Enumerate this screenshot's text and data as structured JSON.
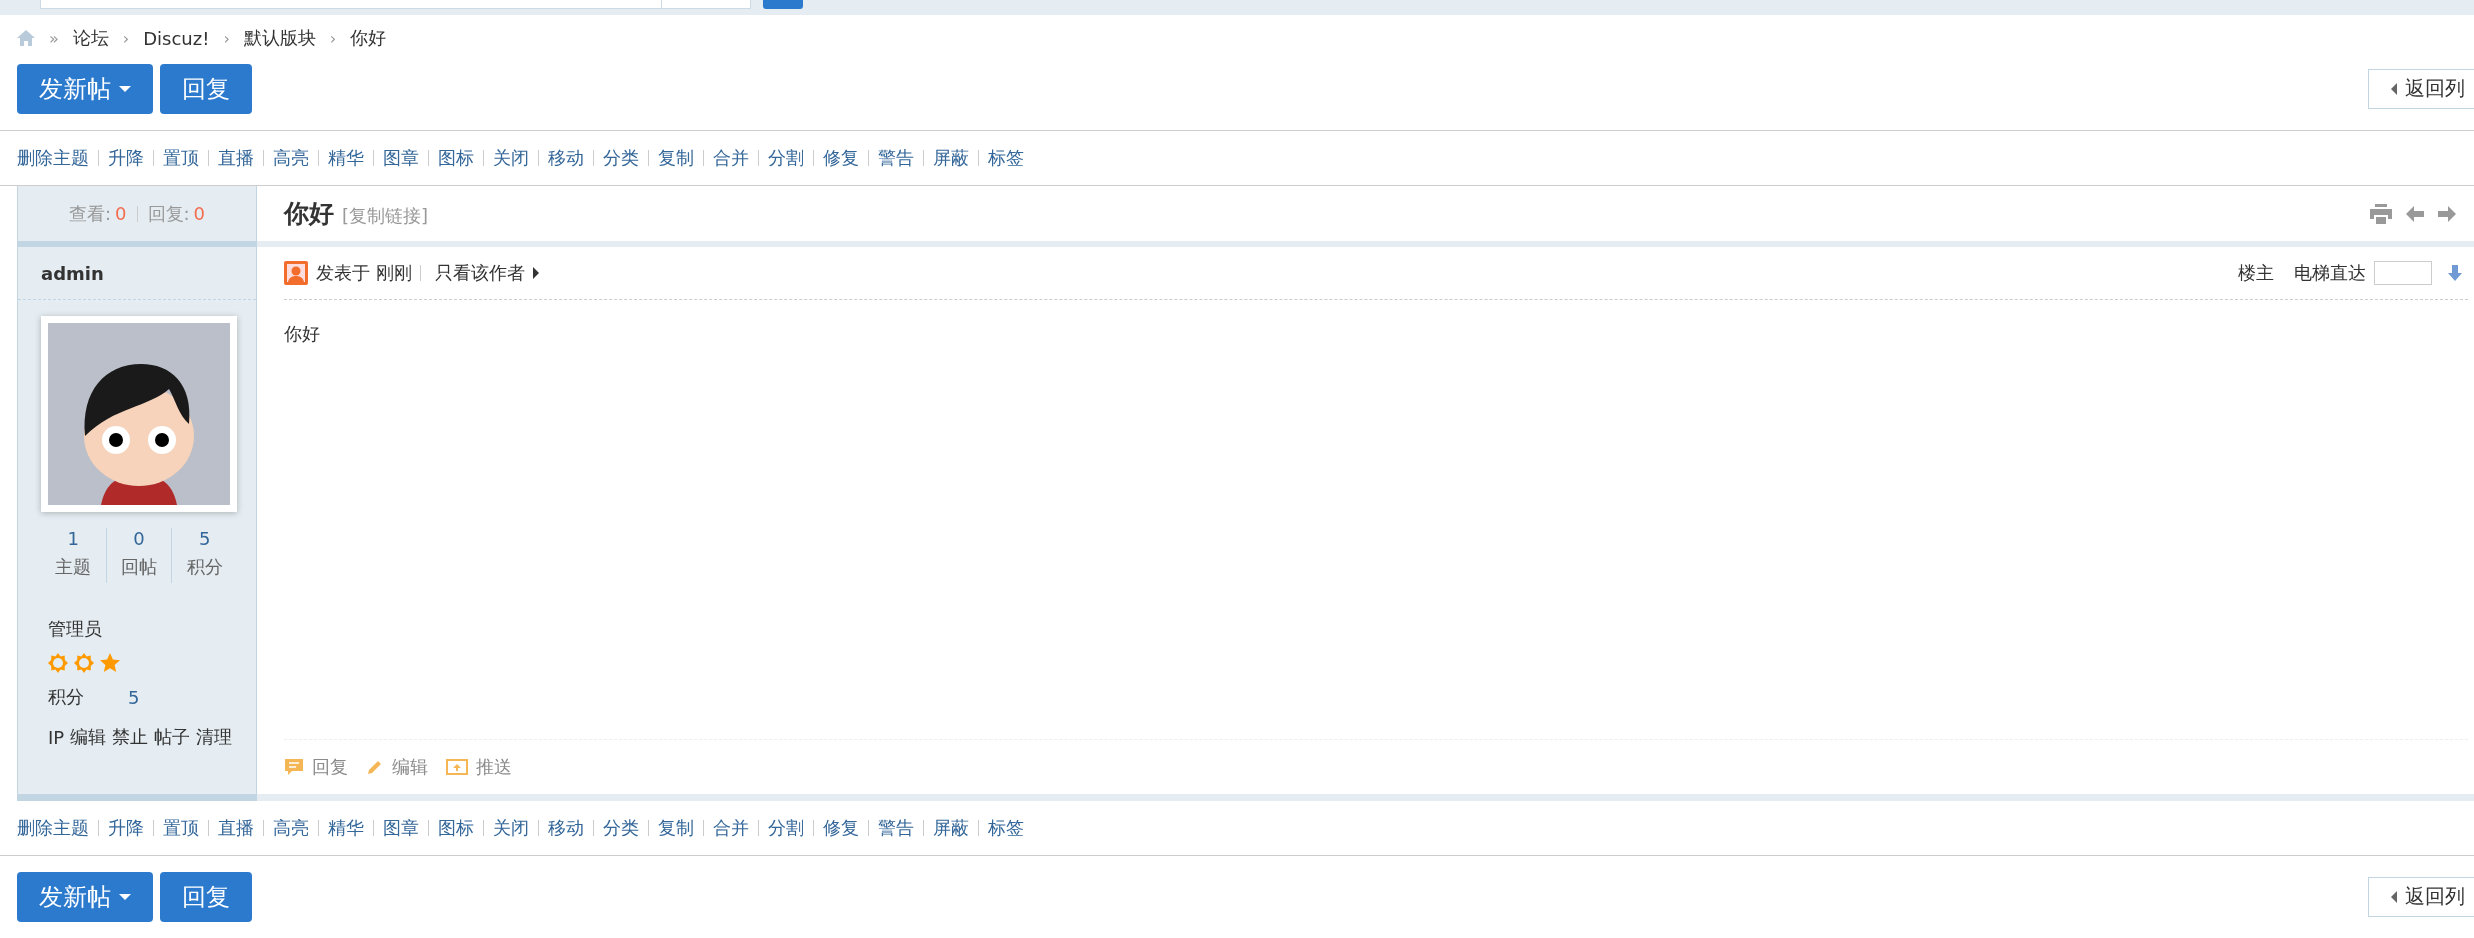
{
  "breadcrumb": [
    {
      "separator": "»",
      "label": "论坛"
    },
    {
      "separator": "›",
      "label": "Discuz!"
    },
    {
      "separator": "›",
      "label": "默认版块"
    },
    {
      "separator": "›",
      "label": "你好"
    }
  ],
  "top_actions": {
    "new_post": "发新帖",
    "reply": "回复",
    "back": "返回列"
  },
  "mod_links_top": [
    "删除主题",
    "升降",
    "置顶",
    "直播",
    "高亮",
    "精华",
    "图章",
    "图标",
    "关闭",
    "移动",
    "分类",
    "复制",
    "合并",
    "分割",
    "修复",
    "警告",
    "屏蔽",
    "标签"
  ],
  "thread": {
    "stats": [
      {
        "label": "查看:",
        "value": "0"
      },
      {
        "label": "回复:",
        "value": "0"
      }
    ],
    "title": "你好",
    "copy_link": "[复制链接]"
  },
  "post": {
    "author": "admin",
    "user_stats": [
      {
        "value": "1",
        "label": "主题"
      },
      {
        "value": "0",
        "label": "回帖"
      },
      {
        "value": "5",
        "label": "积分"
      }
    ],
    "group": "管理员",
    "rank_icons": [
      {
        "kind": "sun"
      },
      {
        "kind": "sun"
      },
      {
        "kind": "star"
      }
    ],
    "credits": {
      "label": "积分",
      "value": "5"
    },
    "admin_links": [
      "IP",
      "编辑",
      "禁止",
      "帖子",
      "清理"
    ],
    "posted": "发表于 刚刚",
    "author_only": "只看该作者",
    "floor": "楼主",
    "jump_label": "电梯直达",
    "content": "你好",
    "actions": [
      {
        "kind": "reply",
        "label": "回复",
        "disabled": true
      },
      {
        "kind": "edit",
        "label": "编辑",
        "disabled": true
      },
      {
        "kind": "push",
        "label": "推送",
        "disabled": true
      }
    ]
  },
  "mod_links_bottom": [
    "删除主题",
    "升降",
    "置顶",
    "直播",
    "高亮",
    "精华",
    "图章",
    "图标",
    "关闭",
    "移动",
    "分类",
    "复制",
    "合并",
    "分割",
    "修复",
    "警告",
    "屏蔽",
    "标签"
  ],
  "bottom_actions": {
    "new_post": "发新帖",
    "reply": "回复",
    "back": "返回列"
  }
}
